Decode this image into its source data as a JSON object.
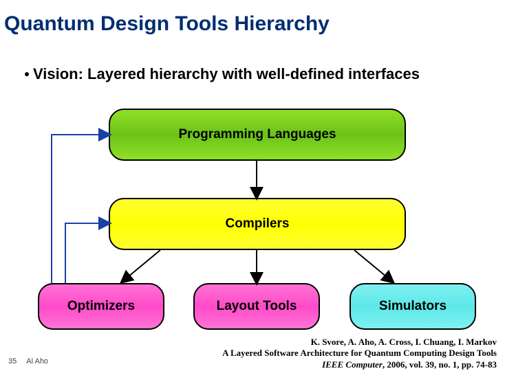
{
  "title": "Quantum Design Tools Hierarchy",
  "bullet": "Vision: Layered hierarchy with well-defined interfaces",
  "boxes": {
    "prog_lang": "Programming Languages",
    "compilers": "Compilers",
    "optimizers": "Optimizers",
    "layout_tools": "Layout Tools",
    "simulators": "Simulators"
  },
  "citation": {
    "authors": "K. Svore, A. Aho, A. Cross, I. Chuang, I. Markov",
    "title": "A Layered Software Architecture for Quantum Computing Design Tools",
    "ref": "IEEE Computer",
    "ref_tail": ", 2006, vol. 39, no. 1, pp. 74-83"
  },
  "footer": {
    "page": "35",
    "author": "Al Aho"
  },
  "colors": {
    "title": "#002d72",
    "green": "#7dd321",
    "yellow": "#ffff00",
    "pink": "#ff55cc",
    "teal": "#66ecec",
    "feedback_line": "#1741a5"
  },
  "chart_data": {
    "type": "hierarchy",
    "nodes": [
      {
        "id": "prog_lang",
        "label": "Programming Languages",
        "color": "green",
        "level": 0
      },
      {
        "id": "compilers",
        "label": "Compilers",
        "color": "yellow",
        "level": 1
      },
      {
        "id": "optimizers",
        "label": "Optimizers",
        "color": "pink",
        "level": 2
      },
      {
        "id": "layout_tools",
        "label": "Layout Tools",
        "color": "pink",
        "level": 2
      },
      {
        "id": "simulators",
        "label": "Simulators",
        "color": "teal",
        "level": 2
      }
    ],
    "edges_down": [
      {
        "from": "prog_lang",
        "to": "compilers"
      },
      {
        "from": "compilers",
        "to": "optimizers"
      },
      {
        "from": "compilers",
        "to": "layout_tools"
      },
      {
        "from": "compilers",
        "to": "simulators"
      }
    ],
    "edges_feedback": [
      {
        "from": "optimizers",
        "to": "compilers"
      },
      {
        "from": "optimizers",
        "to": "prog_lang"
      }
    ]
  }
}
